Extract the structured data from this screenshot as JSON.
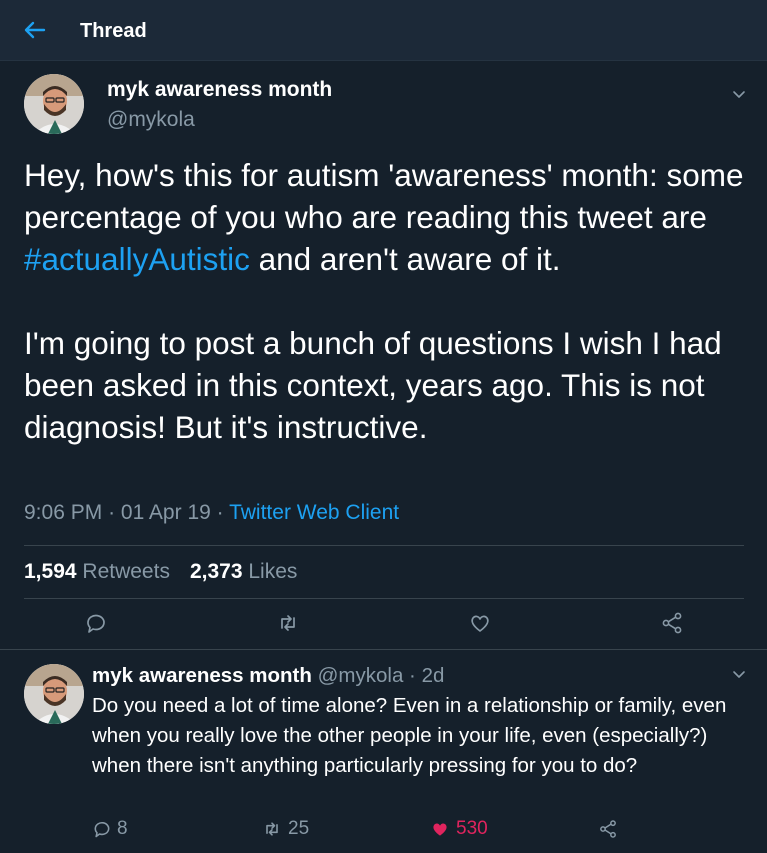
{
  "header": {
    "title": "Thread"
  },
  "tweet": {
    "author_name": "myk awareness month",
    "author_handle": "@mykola",
    "text_part1": "Hey, how's this for autism 'awareness' month: some percentage of you who are reading this tweet are ",
    "hashtag": "#actuallyAutistic",
    "text_part2": " and aren't aware of it.",
    "text_para2": "I'm going to post a bunch of questions I wish I had been asked in this context, years ago. This is not diagnosis! But it's instructive.",
    "time": "9:06 PM",
    "date": "01 Apr 19",
    "source": "Twitter Web Client",
    "retweets_count": "1,594",
    "retweets_label": "Retweets",
    "likes_count": "2,373",
    "likes_label": "Likes"
  },
  "reply": {
    "author_name": "myk awareness month",
    "author_handle": "@mykola",
    "age": "2d",
    "text": "Do you need a lot of time alone? Even in a relationship or family, even when you really love the other people in your life, even (especially?) when there isn't anything particularly pressing for you to do?",
    "replies_count": "8",
    "retweets_count": "25",
    "likes_count": "530"
  },
  "colors": {
    "background": "#15202b",
    "accent": "#1da1f2",
    "muted": "#8899a6",
    "like": "#e0245e"
  },
  "icons": [
    "back-arrow-icon",
    "chevron-down-icon",
    "reply-icon",
    "retweet-icon",
    "like-icon",
    "share-icon"
  ]
}
